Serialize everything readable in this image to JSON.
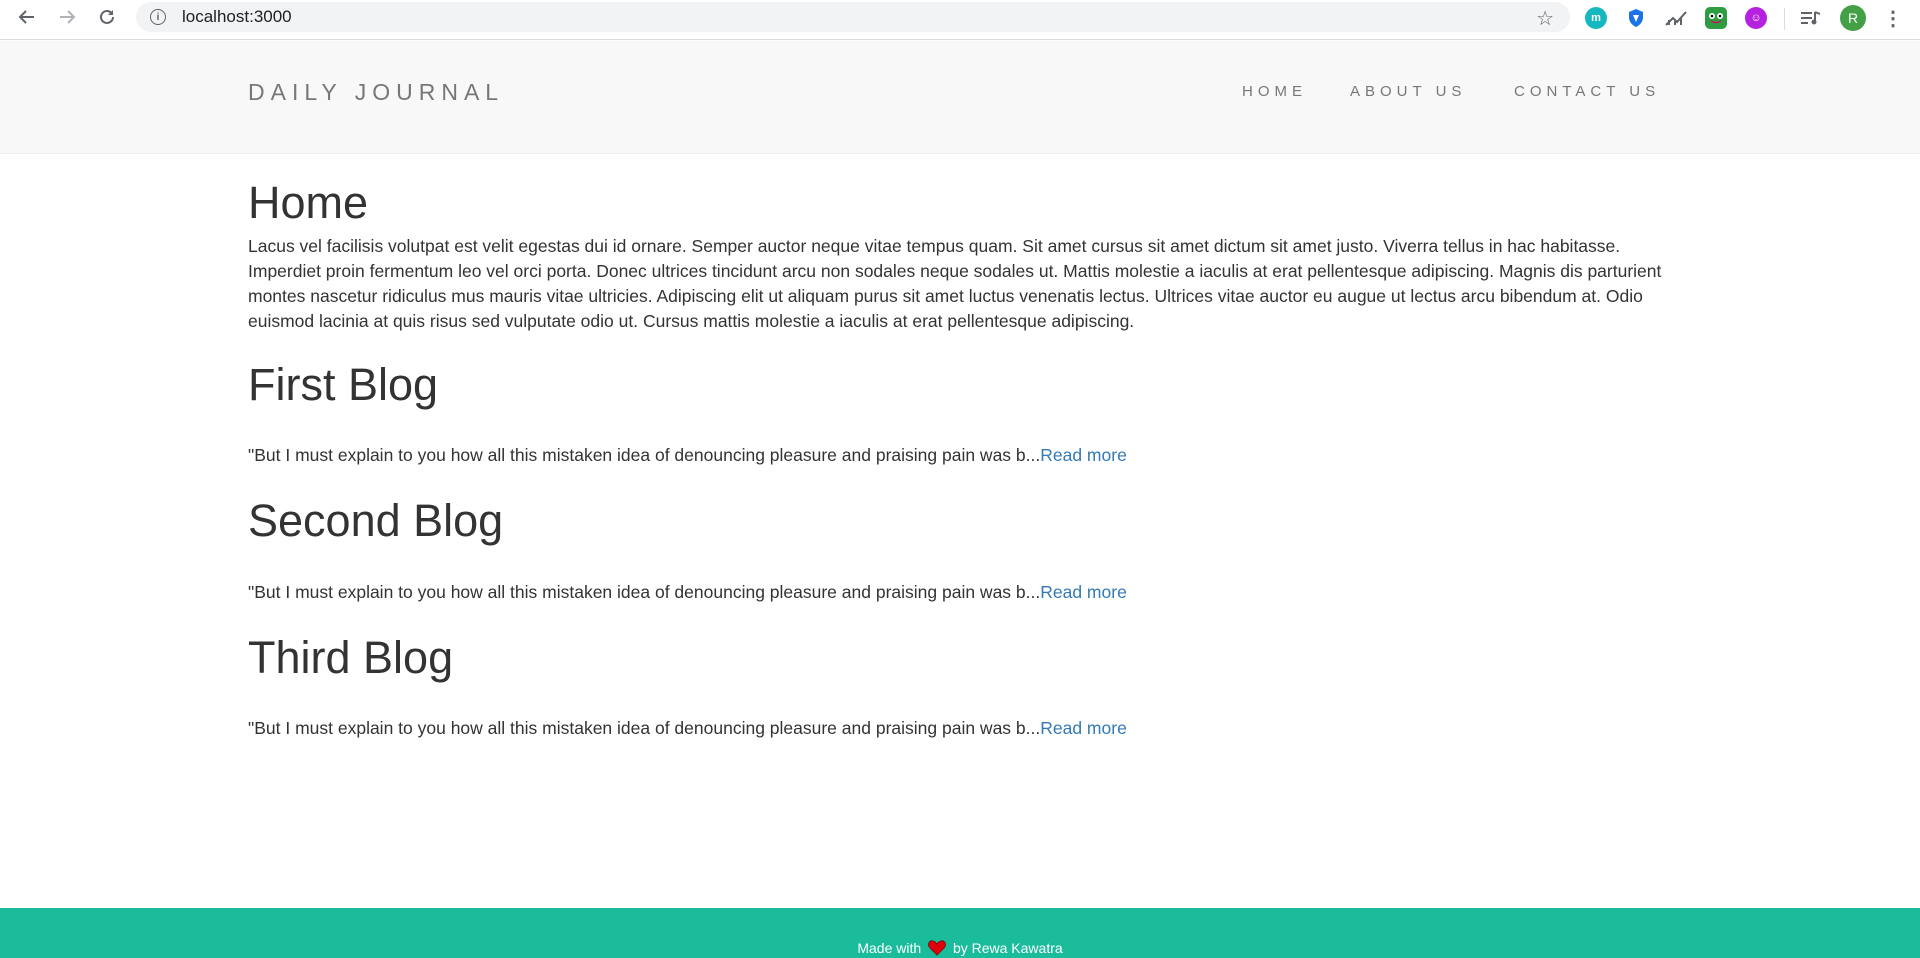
{
  "browser": {
    "url": "localhost:3000",
    "profile_initial": "R",
    "extensions": [
      {
        "icon": "m-extension-icon",
        "color": "#16b8c0",
        "glyph": "m"
      },
      {
        "icon": "shield-extension-icon",
        "color": "#1a73e8",
        "glyph": ""
      },
      {
        "icon": "chart-extension-icon",
        "color": "#5f6368",
        "glyph": ""
      },
      {
        "icon": "frog-extension-icon",
        "color": "#2e9c41",
        "glyph": ""
      },
      {
        "icon": "purple-extension-icon",
        "color": "#b620e0",
        "glyph": ""
      }
    ]
  },
  "header": {
    "brand": "DAILY JOURNAL",
    "nav": [
      "HOME",
      "ABOUT US",
      "CONTACT US"
    ]
  },
  "home": {
    "title": "Home",
    "intro": "Lacus vel facilisis volutpat est velit egestas dui id ornare. Semper auctor neque vitae tempus quam. Sit amet cursus sit amet dictum sit amet justo. Viverra tellus in hac habitasse. Imperdiet proin fermentum leo vel orci porta. Donec ultrices tincidunt arcu non sodales neque sodales ut. Mattis molestie a iaculis at erat pellentesque adipiscing. Magnis dis parturient montes nascetur ridiculus mus mauris vitae ultricies. Adipiscing elit ut aliquam purus sit amet luctus venenatis lectus. Ultrices vitae auctor eu augue ut lectus arcu bibendum at. Odio euismod lacinia at quis risus sed vulputate odio ut. Cursus mattis molestie a iaculis at erat pellentesque adipiscing."
  },
  "posts": [
    {
      "title": "First Blog",
      "excerpt": "\"But I must explain to you how all this mistaken idea of denouncing pleasure and praising pain was b...",
      "link": "Read more"
    },
    {
      "title": "Second Blog",
      "excerpt": "\"But I must explain to you how all this mistaken idea of denouncing pleasure and praising pain was b...",
      "link": "Read more"
    },
    {
      "title": "Third Blog",
      "excerpt": "\"But I must explain to you how all this mistaken idea of denouncing pleasure and praising pain was b...",
      "link": "Read more"
    }
  ],
  "footer": {
    "made_with": "Made with",
    "by": "by Rewa Kawatra",
    "heart_color": "#e0000b",
    "background": "#1abc9c"
  }
}
